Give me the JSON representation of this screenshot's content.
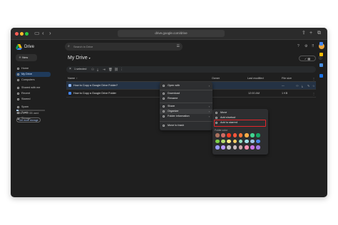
{
  "browser": {
    "url": "drive.google.com/drive"
  },
  "app": {
    "name": "Drive",
    "new_label": "New",
    "search_placeholder": "Search in Drive"
  },
  "sidebar": {
    "items": [
      {
        "label": "Home",
        "active": false
      },
      {
        "label": "My Drive",
        "active": true
      },
      {
        "label": "Computers",
        "active": false
      },
      {
        "label": "Shared with me",
        "active": false
      },
      {
        "label": "Recent",
        "active": false
      },
      {
        "label": "Starred",
        "active": false
      },
      {
        "label": "Spam",
        "active": false
      },
      {
        "label": "Trash",
        "active": false
      },
      {
        "label": "Storage",
        "active": false
      }
    ],
    "storage_text": "1 GB of 15 GB used",
    "storage_fill": 0.07,
    "storage_button": "Get more storage"
  },
  "main": {
    "title": "My Drive",
    "title_caret": "▾",
    "selection": {
      "count_label": "1 selected"
    },
    "columns": {
      "name": "Name",
      "owner": "Owner",
      "modified": "Last modified",
      "size": "File size"
    },
    "rows": [
      {
        "name": "How to Copy a Google Drive Folder?",
        "modified": "",
        "size": "—",
        "selected": true
      },
      {
        "name": "How to Copy a Google Drive Folder",
        "modified": "12:00 AM",
        "size": "1 KB",
        "selected": false
      }
    ]
  },
  "context_menu": {
    "items": [
      {
        "label": "Open with",
        "has_submenu": true
      },
      {
        "label": "Download",
        "has_submenu": false
      },
      {
        "label": "Rename",
        "has_submenu": false
      },
      {
        "label": "Share",
        "has_submenu": true
      },
      {
        "label": "Organize",
        "has_submenu": true
      },
      {
        "label": "Folder information",
        "has_submenu": true
      },
      {
        "label": "Move to trash",
        "has_submenu": false
      }
    ]
  },
  "organize_submenu": {
    "items": [
      {
        "label": "Move"
      },
      {
        "label": "Add shortcut"
      },
      {
        "label": "Add to starred"
      }
    ],
    "folder_color_label": "Folder color",
    "colors": [
      "#ac725e",
      "#d06b64",
      "#f83a22",
      "#fa573c",
      "#ff7537",
      "#ffad46",
      "#42d692",
      "#16a765",
      "#7bd148",
      "#b3dc6c",
      "#fbe983",
      "#fad165",
      "#92e1c0",
      "#9fe1e7",
      "#9fc6e7",
      "#4986e7",
      "#9a9cff",
      "#b99aff",
      "#c2c2c2",
      "#cabdbf",
      "#cca6ac",
      "#f691b2",
      "#cd74e6",
      "#a47ae2"
    ]
  },
  "colors": {
    "highlight": "#e5252a",
    "accent": "#8ab4f8"
  }
}
